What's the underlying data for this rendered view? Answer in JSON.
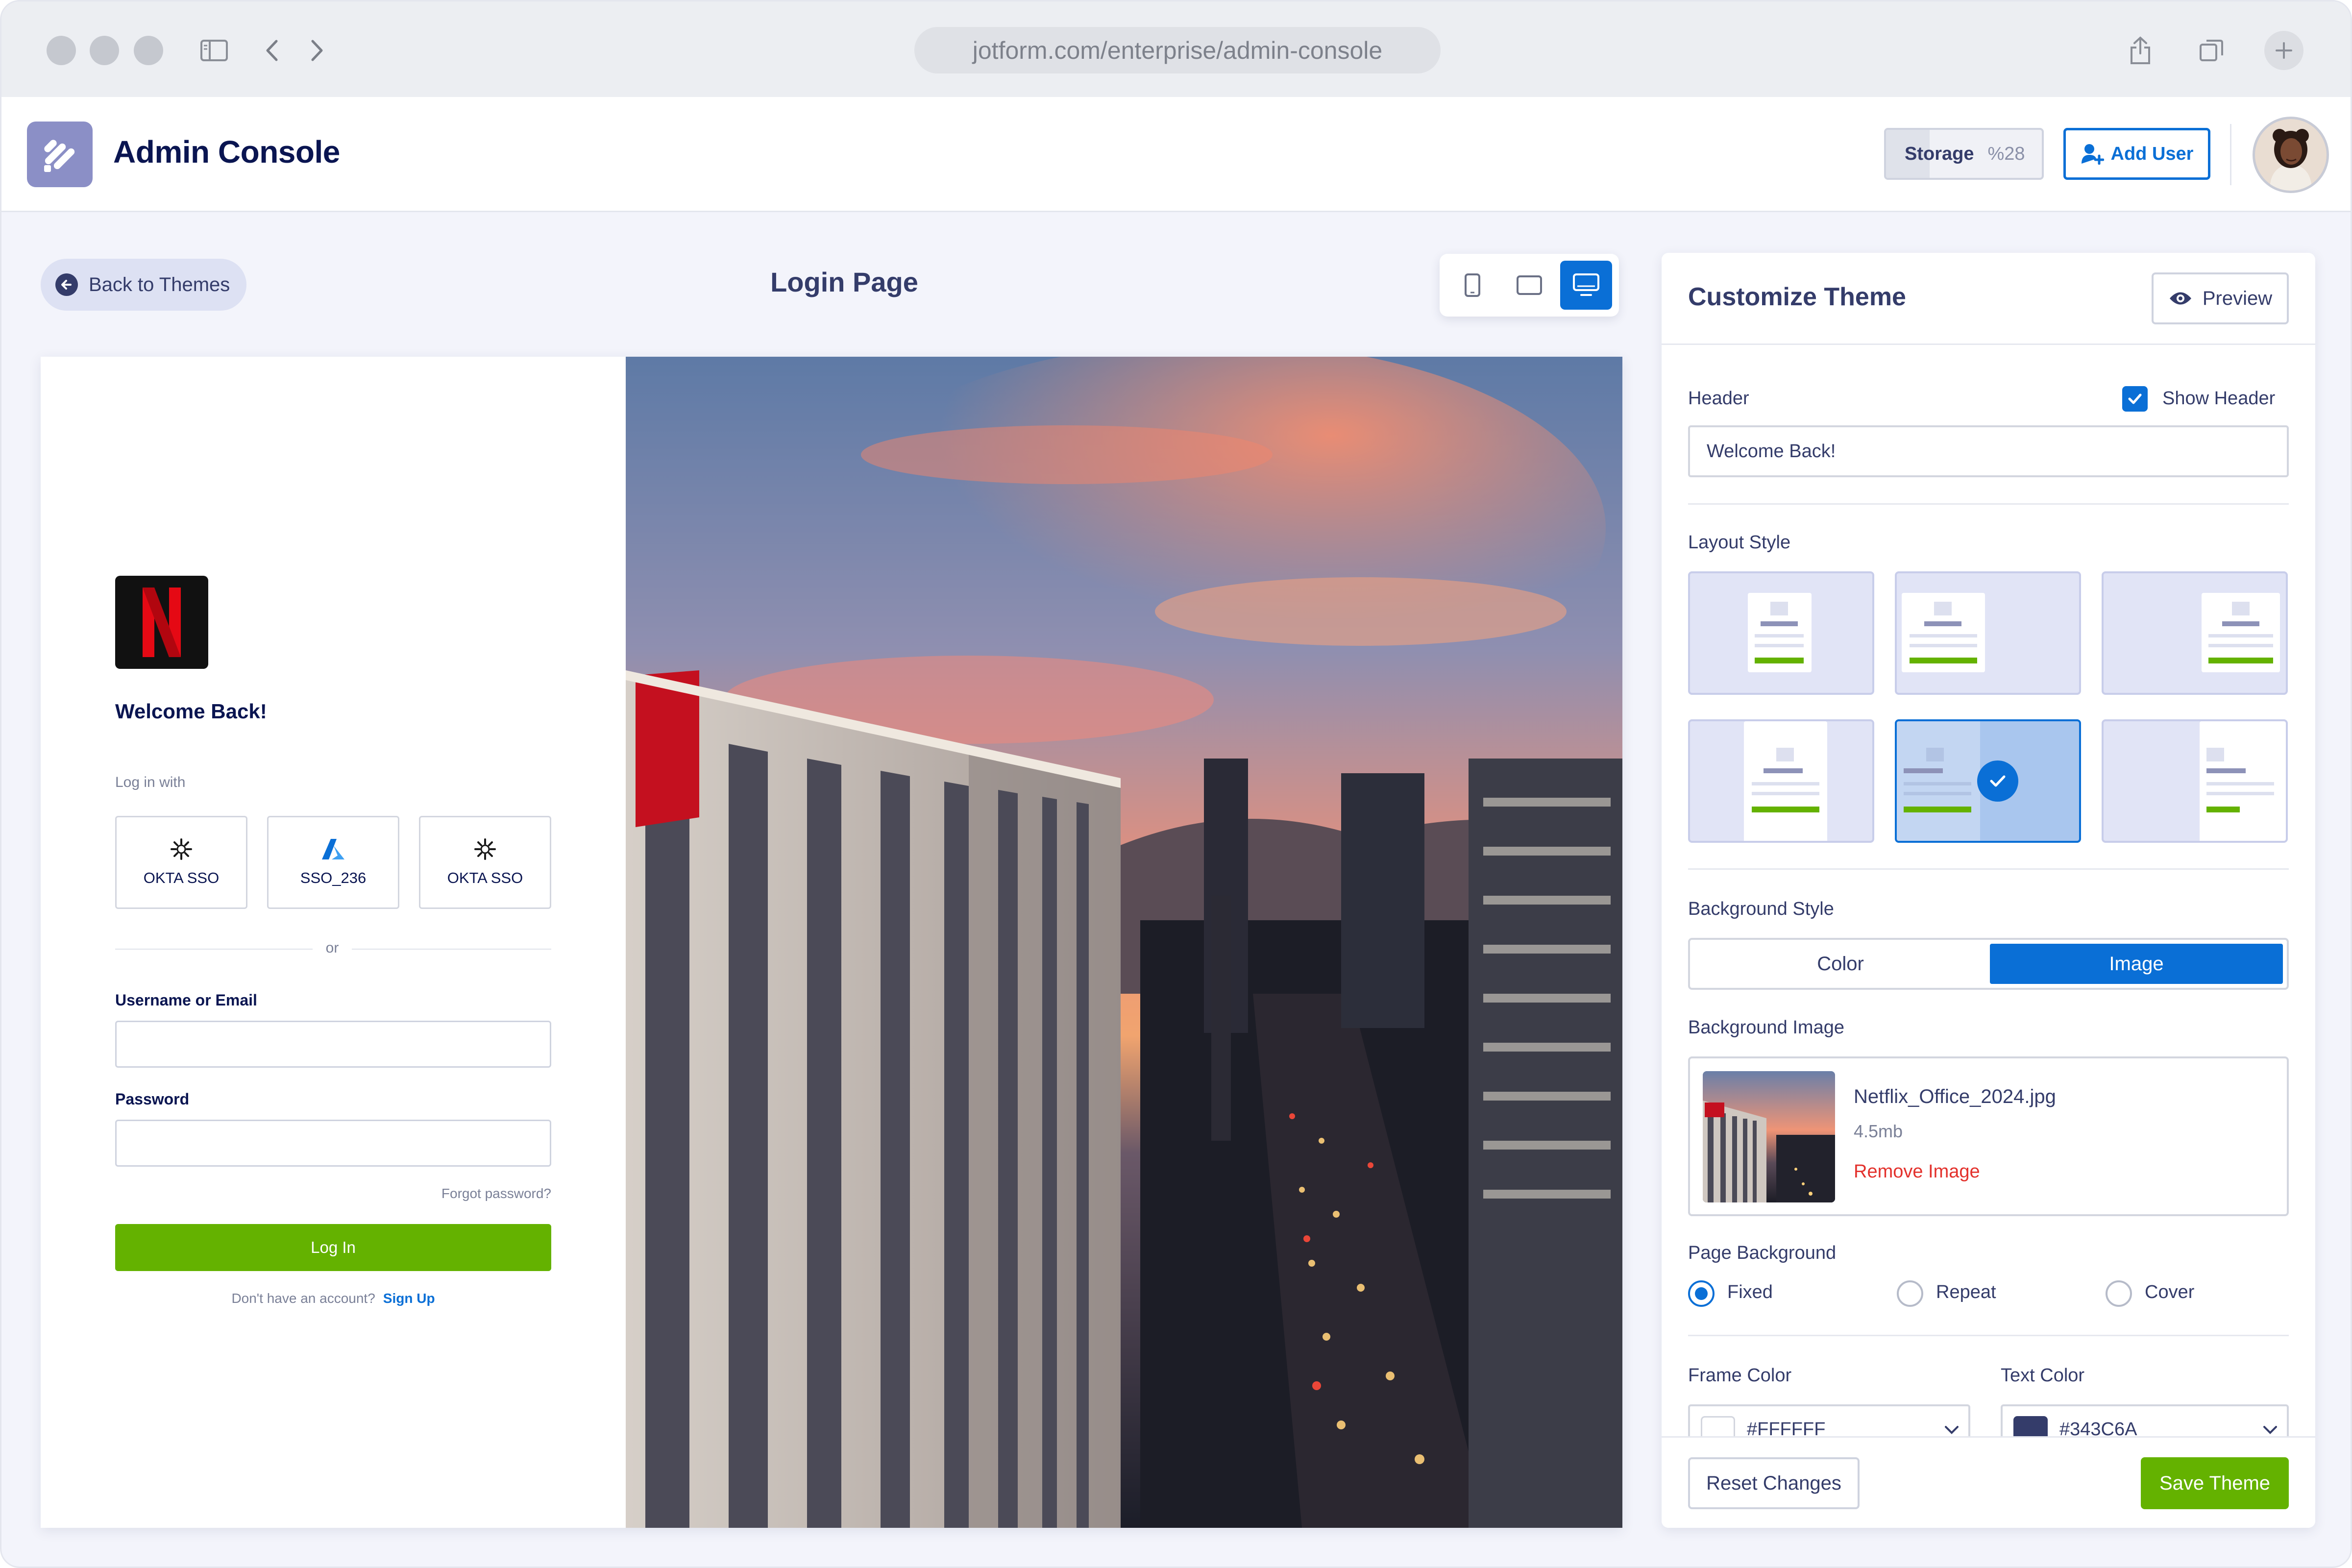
{
  "browser": {
    "url": "jotform.com/enterprise/admin-console",
    "traffic_lights": [
      "close",
      "minimize",
      "zoom"
    ],
    "icons": [
      "sidebar-icon",
      "back-icon",
      "forward-icon",
      "share-icon",
      "tabs-icon",
      "new-tab-icon"
    ]
  },
  "header": {
    "app_title": "Admin Console",
    "storage_label": "Storage",
    "storage_percent": "%28",
    "storage_used_fraction": 0.28,
    "add_user_label": "Add User"
  },
  "toolbar": {
    "back_label": "Back to Themes",
    "page_title": "Login Page",
    "devices": [
      "mobile",
      "tablet",
      "desktop"
    ],
    "active_device": "desktop"
  },
  "login_preview": {
    "brand_letter": "N",
    "welcome": "Welcome Back!",
    "login_with": "Log in with",
    "sso": [
      "OKTA SSO",
      "SSO_236",
      "OKTA SSO"
    ],
    "or": "or",
    "username_label": "Username or Email",
    "password_label": "Password",
    "forgot": "Forgot password?",
    "login_button": "Log In",
    "no_account": "Don't have an account?",
    "signup": "Sign Up"
  },
  "panel": {
    "title": "Customize Theme",
    "preview_label": "Preview",
    "header_label": "Header",
    "show_header_label": "Show Header",
    "show_header_checked": true,
    "header_value": "Welcome Back!",
    "layout_label": "Layout Style",
    "layout_selected_index": 4,
    "bg_style_label": "Background Style",
    "bg_style_options": [
      "Color",
      "Image"
    ],
    "bg_style_selected": "Image",
    "bg_image_label": "Background Image",
    "file_name": "Netflix_Office_2024.jpg",
    "file_size": "4.5mb",
    "remove_label": "Remove Image",
    "page_bg_label": "Page Background",
    "page_bg_options": [
      "Fixed",
      "Repeat",
      "Cover"
    ],
    "page_bg_selected": "Fixed",
    "frame_color_label": "Frame Color",
    "frame_color_value": "#FFFFFF",
    "text_color_label": "Text Color",
    "text_color_value": "#343C6A",
    "reset_label": "Reset Changes",
    "save_label": "Save Theme"
  },
  "colors": {
    "accent": "#0A6FD6",
    "success": "#64B200",
    "text_dark": "#343C6A",
    "brand_red": "#E50914"
  }
}
